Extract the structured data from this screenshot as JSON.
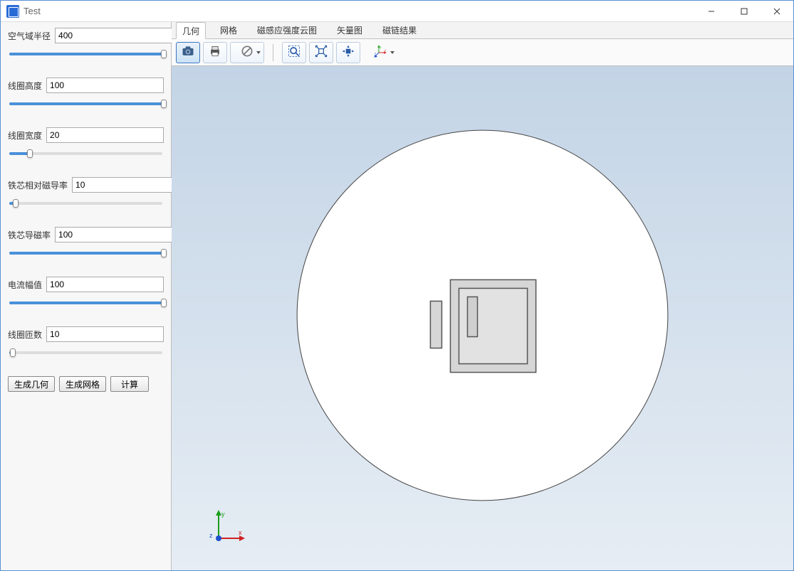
{
  "window": {
    "title": "Test"
  },
  "params": [
    {
      "label": "空气域半径",
      "value": "400",
      "percent": 100
    },
    {
      "label": "线圈高度",
      "value": "100",
      "percent": 100
    },
    {
      "label": "线圈宽度",
      "value": "20",
      "percent": 14
    },
    {
      "label": "铁芯相对磁导率",
      "value": "10",
      "percent": 5
    },
    {
      "label": "铁芯导磁率",
      "value": "100",
      "percent": 100
    },
    {
      "label": "电流幅值",
      "value": "100",
      "percent": 100
    },
    {
      "label": "线圈匝数",
      "value": "10",
      "percent": 3
    }
  ],
  "buttons": {
    "gen_geometry": "生成几何",
    "gen_mesh": "生成网格",
    "compute": "计算"
  },
  "tabs": [
    {
      "label": "几何",
      "active": true
    },
    {
      "label": "网格",
      "active": false
    },
    {
      "label": "磁感应强度云图",
      "active": false
    },
    {
      "label": "矢量图",
      "active": false
    },
    {
      "label": "磁链结果",
      "active": false
    }
  ],
  "toolbar_icons": {
    "screenshot": "screenshot-icon",
    "print": "print-icon",
    "hide": "forbidden-icon",
    "zoom_box": "zoom-box-icon",
    "fit": "fit-extents-icon",
    "reset": "reset-view-icon",
    "axis_menu": "axis-menu-icon"
  },
  "triad": {
    "x": "x",
    "y": "y",
    "z": "z"
  }
}
